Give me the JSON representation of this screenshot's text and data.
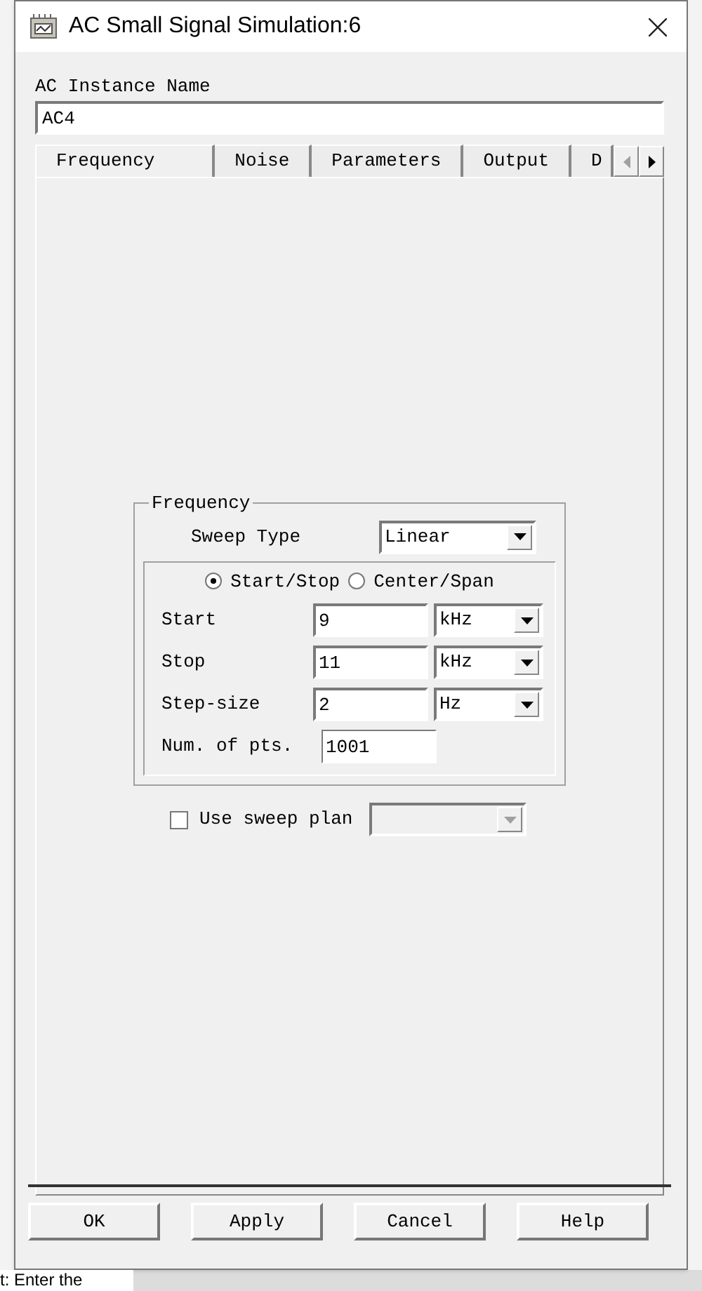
{
  "window": {
    "title": "AC Small Signal Simulation:6"
  },
  "instance_name": {
    "label": "AC Instance Name",
    "value": "AC4"
  },
  "tabs": [
    {
      "label": "Frequency",
      "selected": true
    },
    {
      "label": "Noise",
      "selected": false
    },
    {
      "label": "Parameters",
      "selected": false
    },
    {
      "label": "Output",
      "selected": false
    },
    {
      "label": "D",
      "selected": false
    }
  ],
  "frequency": {
    "title": "Frequency",
    "sweep_type": {
      "label": "Sweep Type",
      "value": "Linear"
    },
    "modes": [
      {
        "label": "Start/Stop",
        "selected": true
      },
      {
        "label": "Center/Span",
        "selected": false
      }
    ],
    "rows": [
      {
        "label": "Start",
        "value": "9",
        "unit": "kHz"
      },
      {
        "label": "Stop",
        "value": "11",
        "unit": "kHz"
      },
      {
        "label": "Step-size",
        "value": "2",
        "unit": "Hz"
      }
    ],
    "points": {
      "label": "Num. of pts.",
      "value": "1001"
    }
  },
  "sweep_plan": {
    "label": "Use sweep plan",
    "checked": false,
    "disabled": true
  },
  "buttons": [
    "OK",
    "Apply",
    "Cancel",
    "Help"
  ],
  "background": {
    "status_text": "t: Enter the"
  }
}
